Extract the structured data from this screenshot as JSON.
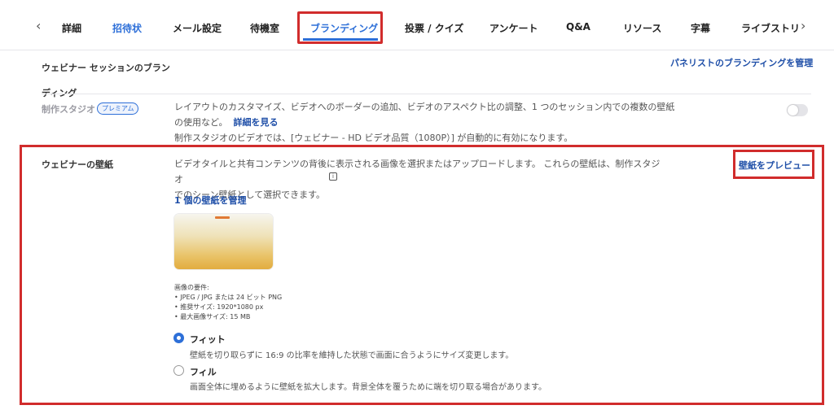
{
  "tabs": {
    "prev_icon": "chevron-left-icon",
    "next_icon": "chevron-right-icon",
    "items": [
      {
        "label": "詳細"
      },
      {
        "label": "招待状"
      },
      {
        "label": "メール設定"
      },
      {
        "label": "待機室"
      },
      {
        "label": "ブランディング"
      },
      {
        "label": "投票 / クイズ"
      },
      {
        "label": "アンケート"
      },
      {
        "label": "Q&A"
      },
      {
        "label": "リソース"
      },
      {
        "label": "字幕"
      },
      {
        "label": "ライブストリ"
      }
    ]
  },
  "section": {
    "title": "ウェビナー セッションのブランディング",
    "title_line1": "ウェビナー セッションのブラン",
    "title_line2": "ディング",
    "panelist_link": "パネリストのブランディングを管理"
  },
  "studio": {
    "label": "制作スタジオ",
    "badge": "プレミアム",
    "desc_line1": "レイアウトのカスタマイズ、ビデオへのボーダーの追加、ビデオのアスペクト比の調整、1 つのセッション内での複数の壁紙",
    "desc_line2": "の使用など。",
    "more_link": "詳細を見る",
    "desc_line3": "制作スタジオのビデオでは、[ウェビナー - HD ビデオ品質（1080P）] が自動的に有効になります。",
    "toggle_on": false
  },
  "wallpaper": {
    "label": "ウェビナーの壁紙",
    "desc_line1": "ビデオタイルと共有コンテンツの背後に表示される画像を選択またはアップロードします。 これらの壁紙は、制作スタジオ",
    "desc_line2": "でのシーン壁紙として選択できます。",
    "preview_link": "壁紙をプレビュー",
    "manage_link": "1 個の壁紙を管理",
    "requirements_title": "画像の要件:",
    "requirements": [
      "JPEG / JPG または 24 ビット PNG",
      "推奨サイズ: 1920*1080 px",
      "最大画像サイズ: 15 MB"
    ],
    "options": [
      {
        "label": "フィット",
        "desc": "壁紙を切り取らずに 16:9 の比率を維持した状態で画面に合うようにサイズ変更します。",
        "selected": true
      },
      {
        "label": "フィル",
        "desc": "画面全体に埋めるように壁紙を拡大します。背景全体を覆うために端を切り取る場合があります。",
        "selected": false
      }
    ]
  },
  "colors": {
    "accent": "#2d6fd8",
    "link": "#1f4fa8",
    "highlight": "#d12c2c"
  }
}
